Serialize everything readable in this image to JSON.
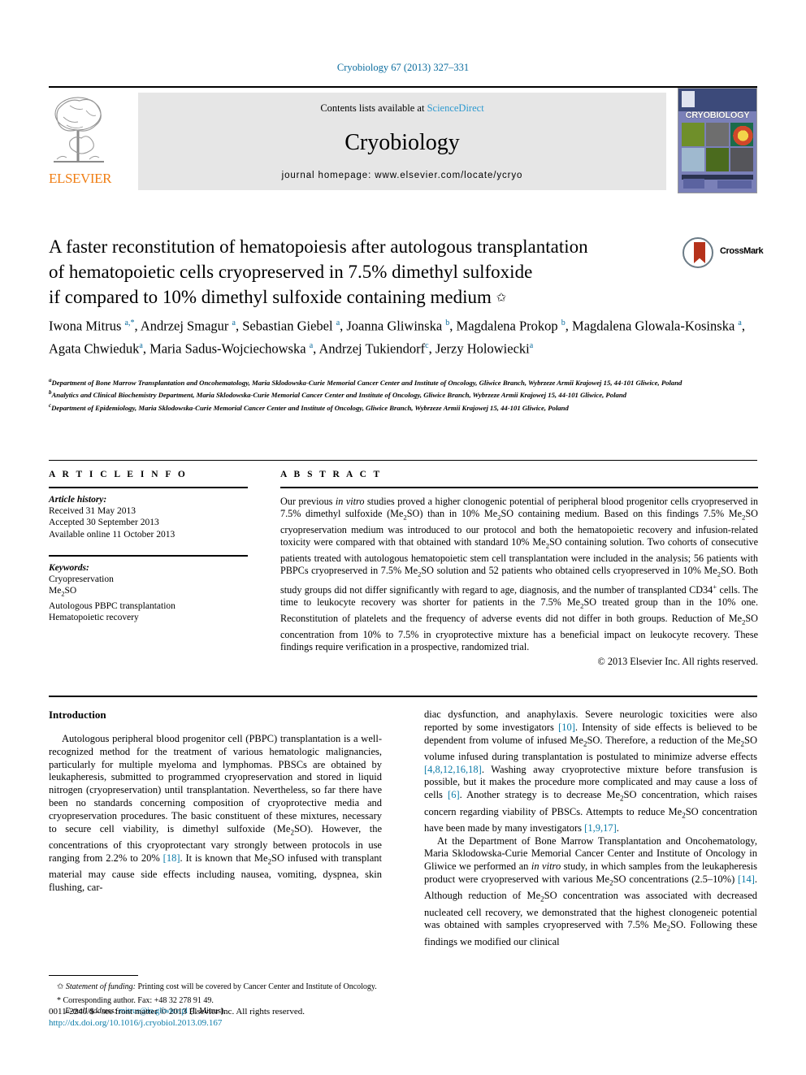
{
  "runhead": "Cryobiology 67 (2013) 327–331",
  "banner": {
    "contents_prefix": "Contents lists available at ",
    "sciencedirect": "ScienceDirect",
    "journal_title": "Cryobiology",
    "homepage": "journal homepage: www.elsevier.com/locate/ycryo",
    "publisher": "ELSEVIER",
    "cover_title": "CRYOBIOLOGY"
  },
  "article": {
    "title_line1": "A faster reconstitution of hematopoiesis after autologous transplantation",
    "title_line2": "of hematopoietic cells cryopreserved in 7.5% dimethyl sulfoxide",
    "title_line3": "if compared to 10% dimethyl sulfoxide containing medium",
    "title_marker": "✩",
    "crossmark_label": "CrossMark",
    "authors_html": "Iwona Mitrus <sup>a,*</sup>, Andrzej Smagur <sup>a</sup>, Sebastian Giebel <sup>a</sup>, Joanna Gliwinska <sup>b</sup>, Magdalena Prokop <sup>b</sup>, Magdalena Glowala-Kosinska <sup>a</sup>, Agata Chwieduk<sup>a</sup>, Maria Sadus-Wojciechowska <sup>a</sup>, Andrzej Tukiendorf<sup>c</sup>, Jerzy Holowiecki<sup>a</sup>",
    "affiliations": [
      "Department of Bone Marrow Transplantation and Oncohematology, Maria Sklodowska-Curie Memorial Cancer Center and Institute of Oncology, Gliwice Branch, Wybrzeze Armii Krajowej 15, 44-101 Gliwice, Poland",
      "Analytics and Clinical Biochemistry Department, Maria Sklodowska-Curie Memorial Cancer Center and Institute of Oncology, Gliwice Branch, Wybrzeze Armii Krajowej 15, 44-101 Gliwice, Poland",
      "Department of Epidemiology, Maria Sklodowska-Curie Memorial Cancer Center and Institute of Oncology, Gliwice Branch, Wybrzeze Armii Krajowej 15, 44-101 Gliwice, Poland"
    ],
    "affiliation_markers": [
      "a",
      "b",
      "c"
    ]
  },
  "info": {
    "heading": "A R T I C L E   I N F O",
    "history_label": "Article history:",
    "history": [
      "Received 31 May 2013",
      "Accepted 30 September 2013",
      "Available online 11 October 2013"
    ],
    "keywords_label": "Keywords:",
    "keywords_html": [
      "Cryopreservation",
      "Me<sub>2</sub>SO",
      "Autologous PBPC transplantation",
      "Hematopoietic recovery"
    ]
  },
  "abstract": {
    "heading": "A B S T R A C T",
    "text_html": "Our previous <i>in vitro</i> studies proved a higher clonogenic potential of peripheral blood progenitor cells cryopreserved in 7.5% dimethyl sulfoxide (Me<sub>2</sub>SO) than in 10% Me<sub>2</sub>SO containing medium. Based on this findings 7.5% Me<sub>2</sub>SO cryopreservation medium was introduced to our protocol and both the hematopoietic recovery and infusion-related toxicity were compared with that obtained with standard 10% Me<sub>2</sub>SO containing solution. Two cohorts of consecutive patients treated with autologous hematopoietic stem cell transplantation were included in the analysis; 56 patients with PBPCs cryopreserved in 7.5% Me<sub>2</sub>SO solution and 52 patients who obtained cells cryopreserved in 10% Me<sub>2</sub>SO. Both study groups did not differ significantly with regard to age, diagnosis, and the number of transplanted CD34<sup class=\"ref-s\">+</sup> cells. The time to leukocyte recovery was shorter for patients in the 7.5% Me<sub>2</sub>SO treated group than in the 10% one. Reconstitution of platelets and the frequency of adverse events did not differ in both groups. Reduction of Me<sub>2</sub>SO concentration from 10% to 7.5% in cryoprotective mixture has a beneficial impact on leukocyte recovery. These findings require verification in a prospective, randomized trial.",
    "copyright": "© 2013 Elsevier Inc. All rights reserved."
  },
  "body": {
    "intro_heading": "Introduction",
    "left_paragraphs_html": [
      "Autologous peripheral blood progenitor cell (PBPC) transplantation is a well-recognized method for the treatment of various hematologic malignancies, particularly for multiple myeloma and lymphomas. PBSCs are obtained by leukapheresis, submitted to programmed cryopreservation and stored in liquid nitrogen (cryopreservation) until transplantation. Nevertheless, so far there have been no standards concerning composition of cryoprotective media and cryopreservation procedures. The basic constituent of these mixtures, necessary to secure cell viability, is dimethyl sulfoxide (Me<sub>2</sub>SO). However, the concentrations of this cryoprotectant vary strongly between protocols in use ranging from 2.2% to 20% <span class=\"ref\">[18]</span>. It is known that Me<sub>2</sub>SO infused with transplant material may cause side effects including nausea, vomiting, dyspnea, skin flushing, car-"
    ],
    "right_paragraphs_html": [
      "diac dysfunction, and anaphylaxis. Severe neurologic toxicities were also reported by some investigators <span class=\"ref\">[10]</span>. Intensity of side effects is believed to be dependent from volume of infused Me<sub>2</sub>SO. Therefore, a reduction of the Me<sub>2</sub>SO volume infused during transplantation is postulated to minimize adverse effects <span class=\"ref\">[4,8,12,16,18]</span>. Washing away cryoprotective mixture before transfusion is possible, but it makes the procedure more complicated and may cause a loss of cells <span class=\"ref\">[6]</span>. Another strategy is to decrease Me<sub>2</sub>SO concentration, which raises concern regarding viability of PBSCs. Attempts to reduce Me<sub>2</sub>SO concentration have been made by many investigators <span class=\"ref\">[1,9,17]</span>.",
      "At the Department of Bone Marrow Transplantation and Oncohematology, Maria Sklodowska-Curie Memorial Cancer Center and Institute of Oncology in Gliwice we performed an <i>in vitro</i> study, in which samples from the leukapheresis product were cryopreserved with various Me<sub>2</sub>SO concentrations (2.5–10%) <span class=\"ref\">[14]</span>. Although reduction of Me<sub>2</sub>SO concentration was associated with decreased nucleated cell recovery, we demonstrated that the highest clonogeneic potential was obtained with samples cryopreserved with 7.5% Me<sub>2</sub>SO. Following these findings we modified our clinical"
    ]
  },
  "footnotes": {
    "funding_html": "<span class=\"it\">Statement of funding:</span> Printing cost will be covered by Cancer Center and Institute of Oncology.",
    "funding_marker": "✩",
    "corresponding_marker": "*",
    "corresponding_html": "Corresponding author. Fax: +48 32 278 91 49.",
    "email_label": "E-mail address:",
    "email": "mitrus@io.gliwice.pl",
    "email_owner": "(I. Mitrus)."
  },
  "issn": {
    "line1": "0011-2240/$ - see front matter © 2013 Elsevier Inc. All rights reserved.",
    "doi": "http://dx.doi.org/10.1016/j.cryobiol.2013.09.167"
  },
  "colors": {
    "link": "#0b7ba8",
    "runhead": "#0b6c9e",
    "elsevier_orange": "#f07e13",
    "sciencedirect": "#2e9ad0",
    "crossmark_red": "#b5321b"
  }
}
